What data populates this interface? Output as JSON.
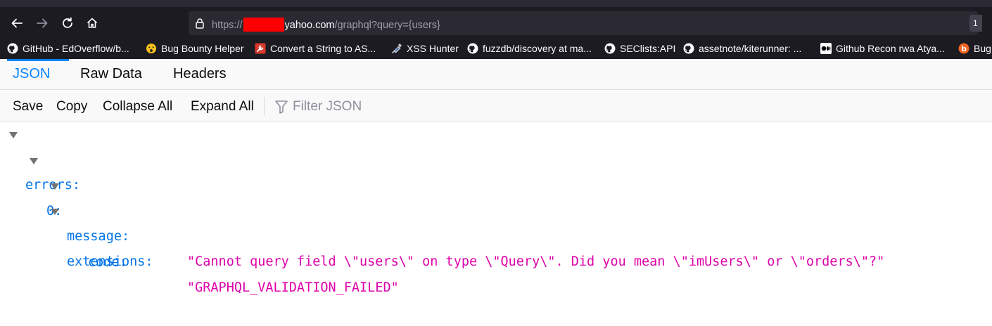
{
  "browser": {
    "url_prefix": "https://",
    "url_host_suffix": "yahoo.com",
    "url_path": "/graphql?query={users}",
    "zoom_label": "1",
    "bookmarks": [
      {
        "label": "GitHub - EdOverflow/b...",
        "icon": "github-icon"
      },
      {
        "label": "Bug Bounty Helper",
        "icon": "emoji-face-icon"
      },
      {
        "label": "Convert a String to AS...",
        "icon": "tool-icon"
      },
      {
        "label": "XSS Hunter",
        "icon": "syringe-icon"
      },
      {
        "label": "fuzzdb/discovery at ma...",
        "icon": "github-icon"
      },
      {
        "label": "SEClists:API",
        "icon": "github-icon"
      },
      {
        "label": "assetnote/kiterunner: ...",
        "icon": "github-icon"
      },
      {
        "label": "Github Recon rwa Atya...",
        "icon": "medium-icon"
      },
      {
        "label": "Bug",
        "icon": "bug-icon"
      }
    ]
  },
  "viewer": {
    "tabs": [
      {
        "label": "JSON",
        "selected": true
      },
      {
        "label": "Raw Data",
        "selected": false
      },
      {
        "label": "Headers",
        "selected": false
      }
    ],
    "toolbar": {
      "save": "Save",
      "copy": "Copy",
      "collapse_all": "Collapse All",
      "expand_all": "Expand All",
      "filter_placeholder": "Filter JSON"
    },
    "tree": {
      "errors_key": "errors:",
      "index_key": "0:",
      "message_key": "message:",
      "message_value": "\"Cannot query field \\\"users\\\" on type \\\"Query\\\". Did you mean \\\"imUsers\\\" or \\\"orders\\\"?\"",
      "extensions_key": "extensions:",
      "code_key": "code:",
      "code_value": "\"GRAPHQL_VALIDATION_FAILED\""
    }
  },
  "colors": {
    "accent": "#0a84ff",
    "json_key": "#0074e8",
    "json_string": "#dd00a9",
    "chrome_bg": "#1c1b22"
  }
}
